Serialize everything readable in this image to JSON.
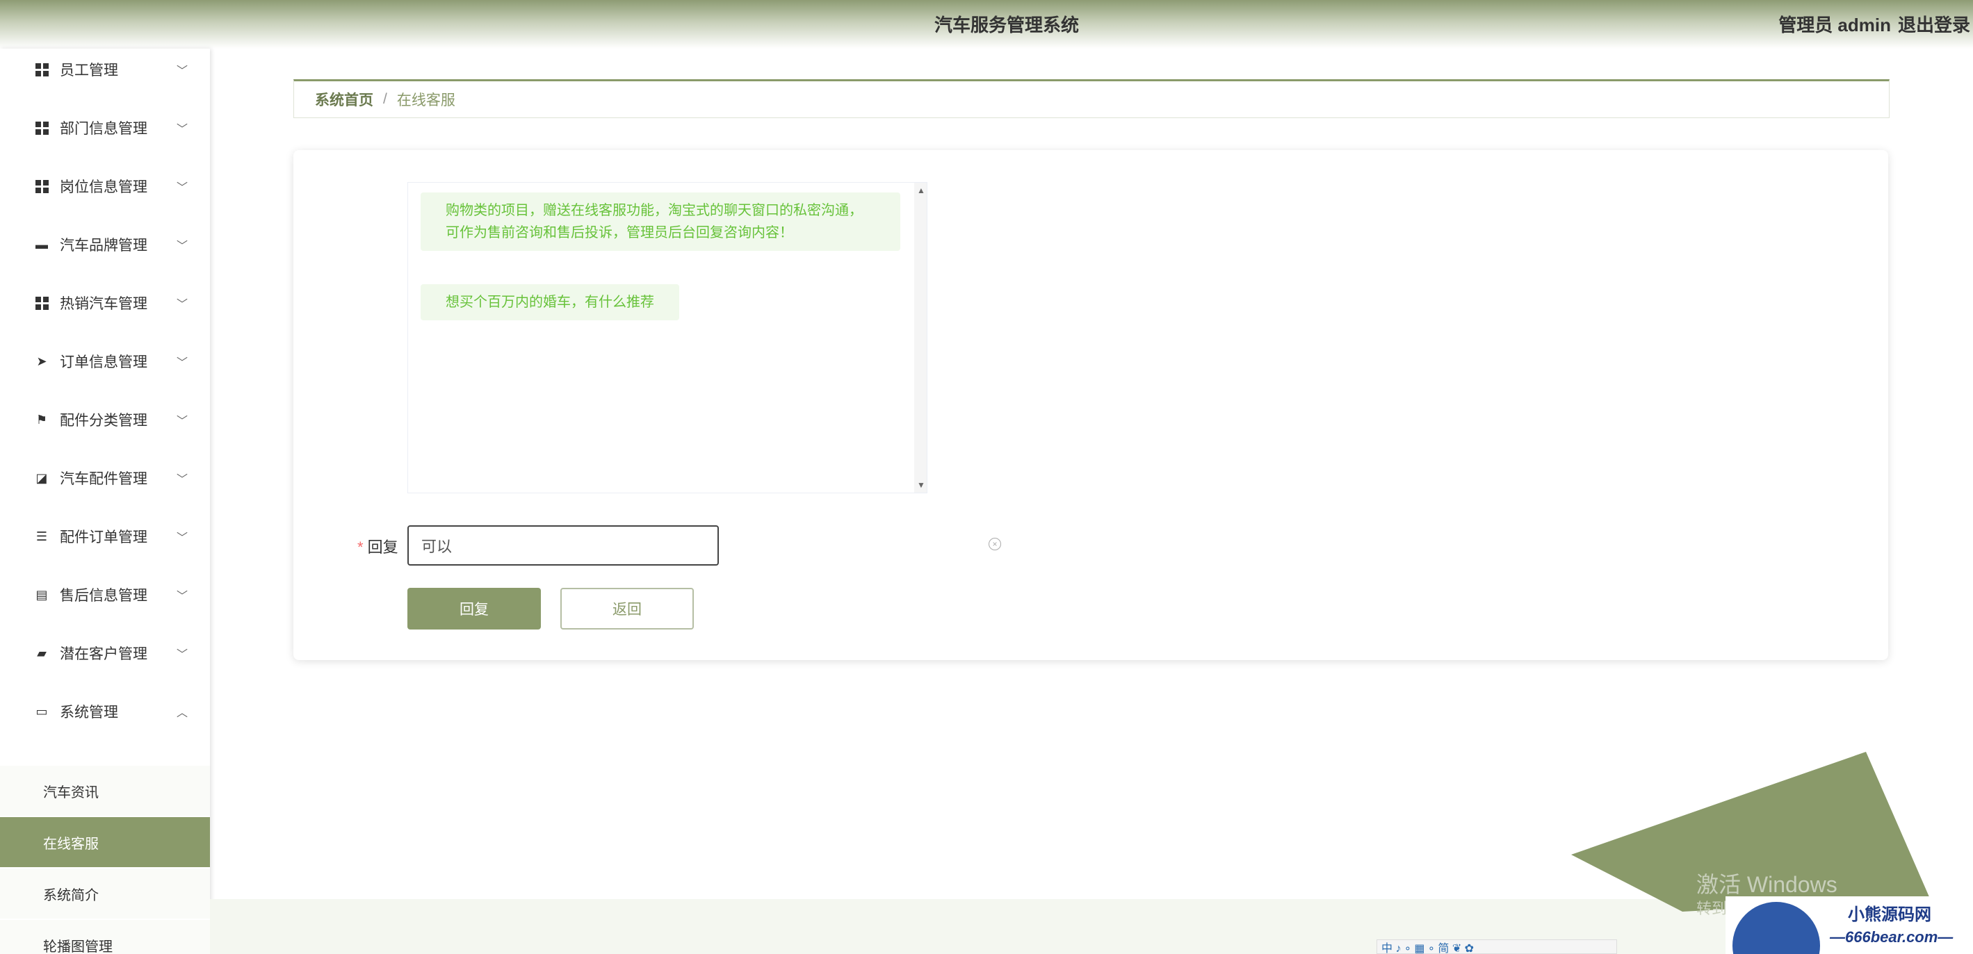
{
  "header": {
    "title": "汽车服务管理系统",
    "user": "管理员 admin",
    "logout": "退出登录"
  },
  "sidebar": {
    "items": [
      {
        "label": "员工管理",
        "icon": "grid-icon"
      },
      {
        "label": "部门信息管理",
        "icon": "grid-icon"
      },
      {
        "label": "岗位信息管理",
        "icon": "grid-icon"
      },
      {
        "label": "汽车品牌管理",
        "icon": "paint-roller-icon"
      },
      {
        "label": "热销汽车管理",
        "icon": "grid-icon"
      },
      {
        "label": "订单信息管理",
        "icon": "paper-plane-icon"
      },
      {
        "label": "配件分类管理",
        "icon": "flag-icon"
      },
      {
        "label": "汽车配件管理",
        "icon": "chart-line-icon"
      },
      {
        "label": "配件订单管理",
        "icon": "list-indent-icon"
      },
      {
        "label": "售后信息管理",
        "icon": "comment-icon"
      },
      {
        "label": "潜在客户管理",
        "icon": "ticket-icon"
      },
      {
        "label": "系统管理",
        "icon": "server-icon"
      }
    ],
    "subitems": [
      {
        "label": "汽车资讯"
      },
      {
        "label": "在线客服"
      },
      {
        "label": "系统简介"
      },
      {
        "label": "轮播图管理"
      }
    ]
  },
  "breadcrumb": {
    "home": "系统首页",
    "separator": "/",
    "current": "在线客服"
  },
  "chat": {
    "messages": [
      {
        "text": "购物类的项目，赠送在线客服功能，淘宝式的聊天窗口的私密沟通，可作为售前咨询和售后投诉，管理员后台回复咨询内容！"
      },
      {
        "text": "想买个百万内的婚车，有什么推荐"
      }
    ]
  },
  "form": {
    "required_mark": "*",
    "reply_label": "回复",
    "reply_value": "可以",
    "submit_label": "回复",
    "back_label": "返回"
  },
  "overlay": {
    "watermark": "激活 Windows",
    "watermark_sub": "转到",
    "brand_name": "小熊源码网",
    "brand_url": "—666bear.com—",
    "taskbar": "中 ♪ ∘ ▦ ∘ 简 ❦ ✿"
  },
  "colors": {
    "accent": "#8a9a6a",
    "bubble_bg": "#f0f9eb",
    "bubble_text": "#67c23a",
    "required": "#f56c6c"
  }
}
